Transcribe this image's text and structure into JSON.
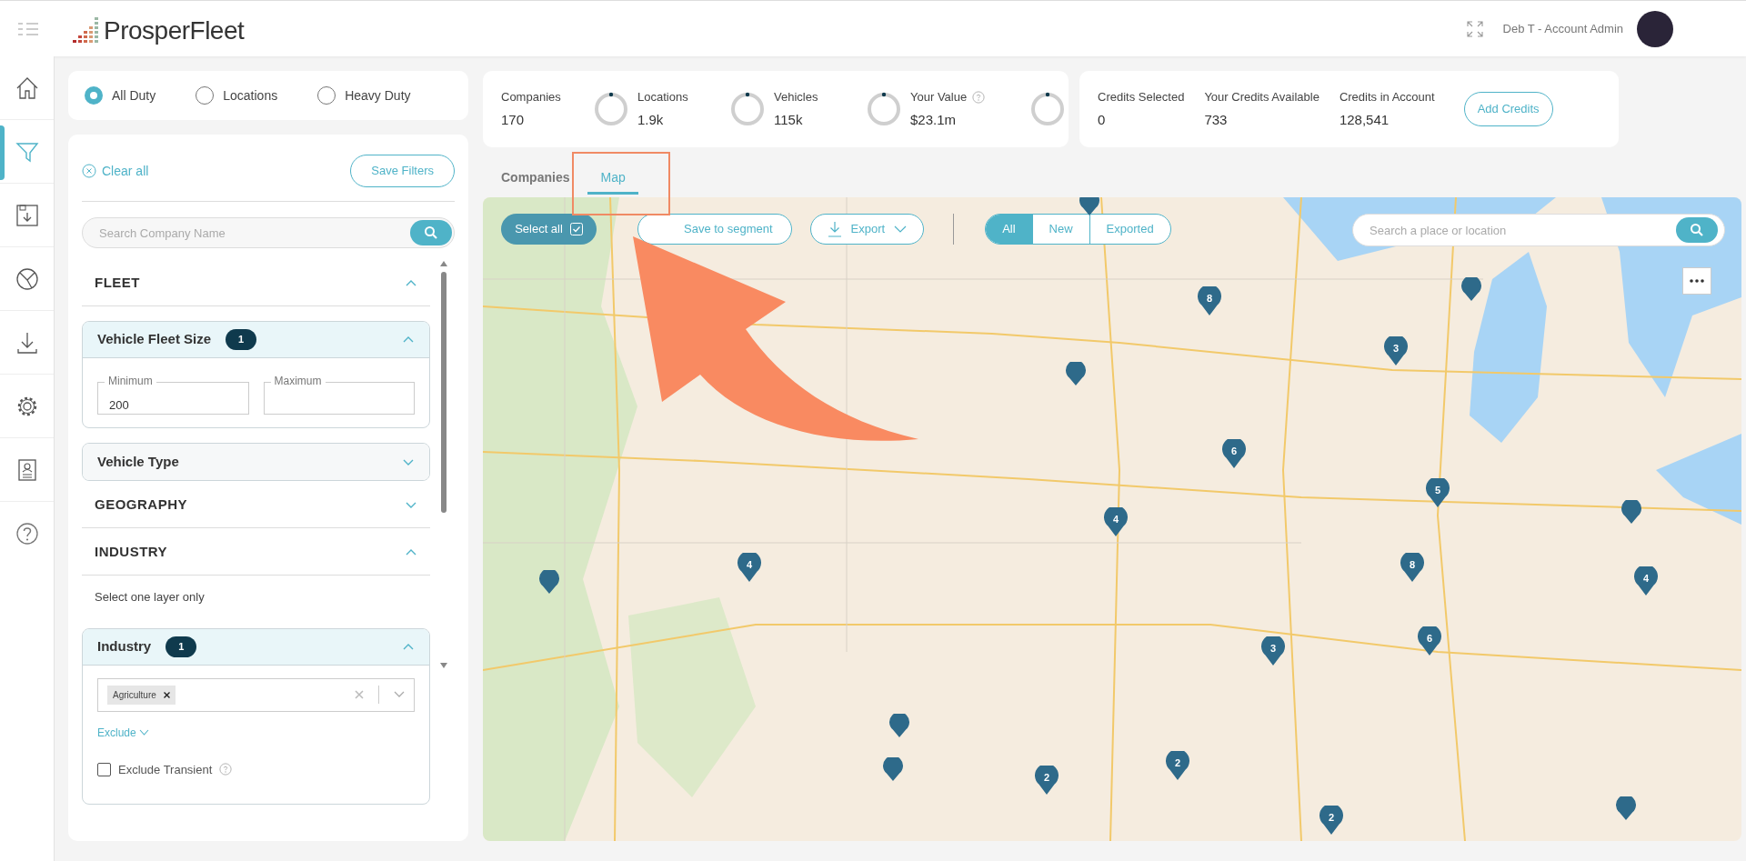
{
  "header": {
    "app_name": "ProsperFleet",
    "user_label": "Deb T - Account Admin"
  },
  "nav_rail": [
    {
      "kind": "home",
      "selected": false
    },
    {
      "kind": "filter",
      "selected": true
    },
    {
      "kind": "save",
      "selected": false
    },
    {
      "kind": "segments",
      "selected": false
    },
    {
      "kind": "download",
      "selected": false
    },
    {
      "kind": "settings",
      "selected": false
    },
    {
      "kind": "contact",
      "selected": false
    },
    {
      "kind": "help",
      "selected": false
    }
  ],
  "duty_options": [
    {
      "label": "All Duty",
      "selected": true
    },
    {
      "label": "Locations",
      "selected": false
    },
    {
      "label": "Heavy Duty",
      "selected": false
    }
  ],
  "filters": {
    "clear_all": "Clear all",
    "save_button": "Save Filters",
    "search_placeholder": "Search Company Name",
    "items": [
      {
        "kind": "section",
        "title": "FLEET",
        "expanded": true
      },
      {
        "kind": "group",
        "title": "Vehicle Fleet Size",
        "badge": "1",
        "expanded": true,
        "fields": [
          {
            "label": "Minimum",
            "value": "200"
          },
          {
            "label": "Maximum"
          }
        ]
      },
      {
        "kind": "group",
        "title": "Vehicle Type",
        "expanded": false
      },
      {
        "kind": "section",
        "title": "GEOGRAPHY",
        "expanded": false
      },
      {
        "kind": "section",
        "title": "INDUSTRY",
        "expanded": true
      },
      {
        "kind": "note",
        "text": "Select one layer only"
      },
      {
        "kind": "group",
        "title": "Industry",
        "badge": "1",
        "expanded": true,
        "tags": [
          "Agriculture"
        ],
        "exclude_link": "Exclude",
        "checkbox": {
          "label": "Exclude Transient",
          "checked": false
        }
      }
    ]
  },
  "stats": [
    {
      "label": "Companies",
      "value": "170"
    },
    {
      "label": "Locations",
      "value": "1.9k"
    },
    {
      "label": "Vehicles",
      "value": "115k"
    },
    {
      "label": "Your Value",
      "value": "$23.1m",
      "help": true
    }
  ],
  "credits": {
    "items": [
      {
        "label": "Credits Selected",
        "value": "0"
      },
      {
        "label": "Your Credits Available",
        "value": "733"
      },
      {
        "label": "Credits in Account",
        "value": "128,541"
      }
    ],
    "button": "Add Credits"
  },
  "tabs": [
    {
      "label": "Companies",
      "selected": false
    },
    {
      "label": "Map",
      "selected": true
    }
  ],
  "map": {
    "select_all": {
      "label": "Select all",
      "checked": true
    },
    "save_segment": "Save to segment",
    "export": "Export",
    "segments": [
      {
        "label": "All",
        "selected": true
      },
      {
        "label": "New",
        "selected": false
      },
      {
        "label": "Exported",
        "selected": false
      }
    ],
    "search_placeholder": "Search a place or location",
    "markers": [
      {
        "kind": "single"
      },
      {
        "kind": "cluster",
        "count": "8"
      },
      {
        "kind": "single"
      },
      {
        "kind": "cluster",
        "count": "3"
      },
      {
        "kind": "single"
      },
      {
        "kind": "cluster",
        "count": "6"
      },
      {
        "kind": "cluster",
        "count": "5"
      },
      {
        "kind": "single"
      },
      {
        "kind": "cluster",
        "count": "4"
      },
      {
        "kind": "cluster",
        "count": "4"
      },
      {
        "kind": "single"
      },
      {
        "kind": "cluster",
        "count": "8"
      },
      {
        "kind": "cluster",
        "count": "4"
      },
      {
        "kind": "cluster",
        "count": "3"
      },
      {
        "kind": "cluster",
        "count": "6"
      },
      {
        "kind": "single"
      },
      {
        "kind": "single"
      },
      {
        "kind": "cluster",
        "count": "2"
      },
      {
        "kind": "cluster",
        "count": "2"
      },
      {
        "kind": "cluster",
        "count": "2"
      },
      {
        "kind": "single"
      }
    ]
  },
  "annotation": {
    "highlight_box": true,
    "arrow": true
  }
}
